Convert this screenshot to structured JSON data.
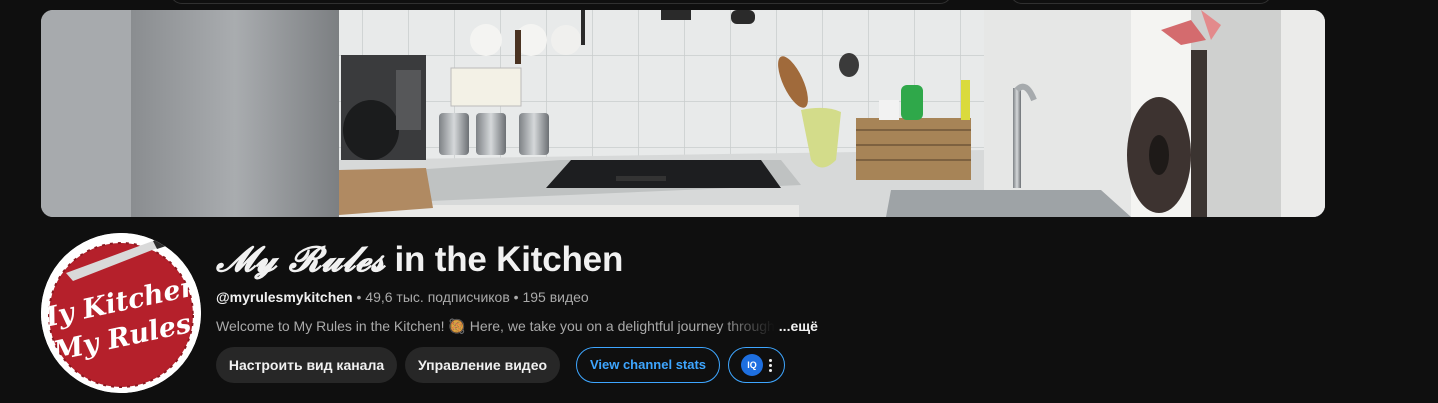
{
  "channel": {
    "name_fancy": "𝓜𝔂 𝓡𝓾𝓵𝓮𝓼",
    "name_rest": " in the Kitchen",
    "handle": "@myrulesmykitchen",
    "separator": " • ",
    "subscribers": "49,6 тыс. подписчиков",
    "videos": "195 видео",
    "description": "Welcome to My Rules in the Kitchen! 🥘 Here, we take you on a delightful journey through",
    "more_label": "...ещё"
  },
  "avatar": {
    "line1": "My Kitchen,",
    "line2": "My Rules!",
    "brand_color": "#b5202b"
  },
  "actions": {
    "customize_label": "Настроить вид канала",
    "manage_label": "Управление видео",
    "stats_label": "View channel stats",
    "extension_icon": "iq-icon",
    "extension_icon_text": "IQ"
  },
  "colors": {
    "background": "#0f0f0f",
    "button_bg": "#272727",
    "accent": "#3ea6ff",
    "secondary_text": "#aaaaaa"
  }
}
